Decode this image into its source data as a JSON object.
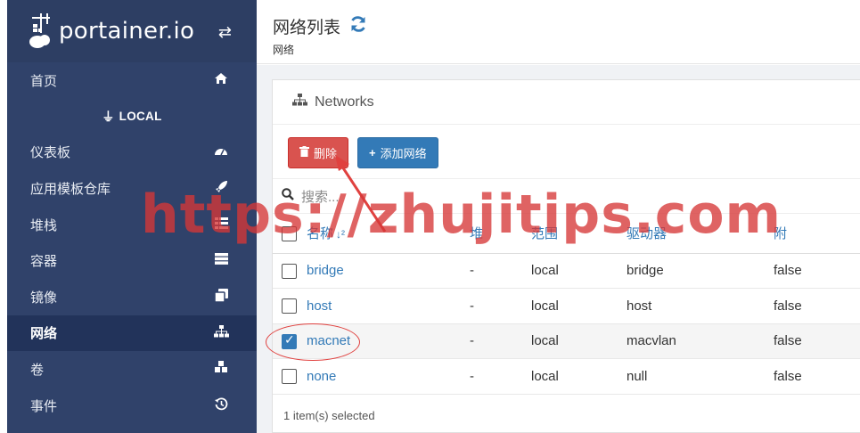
{
  "brand": {
    "name": "portainer.io",
    "toggle_icon": "exchange-icon"
  },
  "sidebar": {
    "home": {
      "label": "首页",
      "icon": "home-icon"
    },
    "endpoint_label": "LOCAL",
    "items": [
      {
        "label": "仪表板",
        "icon": "dashboard-icon"
      },
      {
        "label": "应用模板仓库",
        "icon": "rocket-icon"
      },
      {
        "label": "堆栈",
        "icon": "list-icon"
      },
      {
        "label": "容器",
        "icon": "server-icon"
      },
      {
        "label": "镜像",
        "icon": "clone-icon"
      },
      {
        "label": "网络",
        "icon": "sitemap-icon",
        "active": true
      },
      {
        "label": "卷",
        "icon": "cubes-icon"
      },
      {
        "label": "事件",
        "icon": "history-icon"
      }
    ]
  },
  "header": {
    "title": "网络列表",
    "breadcrumb": "网络"
  },
  "panel": {
    "title": "Networks",
    "remove_label": "删除",
    "add_label": "添加网络",
    "search_placeholder": "搜索..."
  },
  "table": {
    "headers": [
      "名称",
      "堆",
      "范围",
      "驱动器",
      "附"
    ],
    "rows": [
      {
        "name": "bridge",
        "stack": "-",
        "scope": "local",
        "driver": "bridge",
        "attachable": "false",
        "selected": false
      },
      {
        "name": "host",
        "stack": "-",
        "scope": "local",
        "driver": "host",
        "attachable": "false",
        "selected": false
      },
      {
        "name": "macnet",
        "stack": "-",
        "scope": "local",
        "driver": "macvlan",
        "attachable": "false",
        "selected": true
      },
      {
        "name": "none",
        "stack": "-",
        "scope": "local",
        "driver": "null",
        "attachable": "false",
        "selected": false
      }
    ],
    "selection_text": "1 item(s) selected"
  },
  "watermark": "https://zhujitips.com",
  "colors": {
    "sidebar": "#30426a",
    "primary": "#337ab7",
    "danger": "#d9534f",
    "annotation": "#e0413f"
  }
}
